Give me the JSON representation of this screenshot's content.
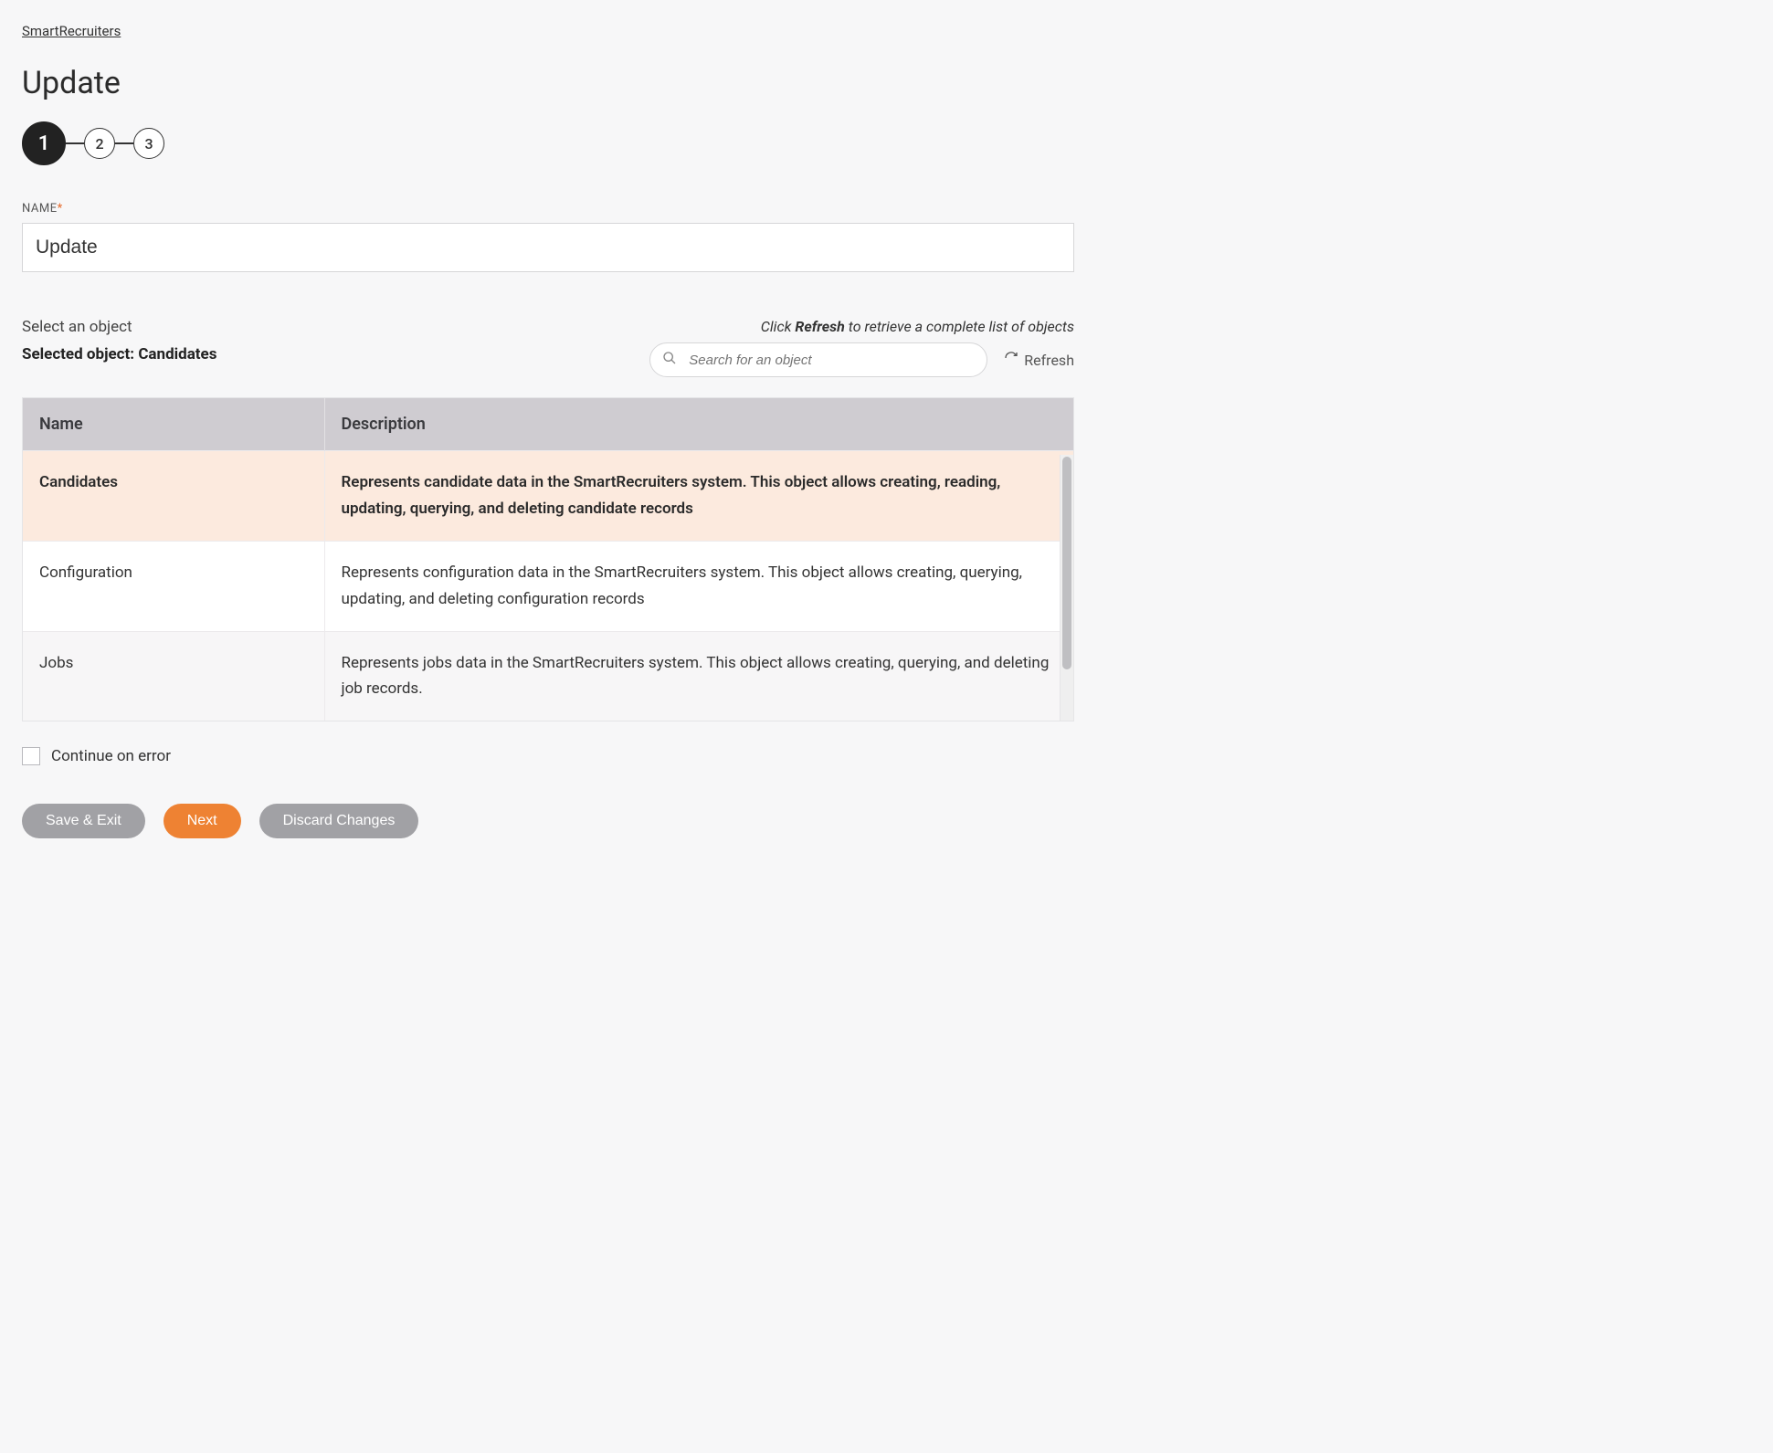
{
  "breadcrumb": "SmartRecruiters",
  "page_title": "Update",
  "stepper": {
    "steps": [
      "1",
      "2",
      "3"
    ],
    "active_index": 0
  },
  "name_field": {
    "label": "NAME",
    "required": "*",
    "value": "Update"
  },
  "object_section": {
    "select_label": "Select an object",
    "selected_prefix": "Selected object: ",
    "selected_name": "Candidates",
    "hint_prefix": "Click ",
    "hint_bold": "Refresh",
    "hint_suffix": " to retrieve a complete list of objects",
    "search_placeholder": "Search for an object",
    "refresh_label": "Refresh"
  },
  "table": {
    "headers": {
      "name": "Name",
      "description": "Description"
    },
    "rows": [
      {
        "name": "Candidates",
        "description": "Represents candidate data in the SmartRecruiters system. This object allows creating, reading, updating, querying, and deleting candidate records",
        "selected": true
      },
      {
        "name": "Configuration",
        "description": "Represents configuration data in the SmartRecruiters system. This object allows creating, querying, updating, and deleting configuration records",
        "selected": false
      },
      {
        "name": "Jobs",
        "description": "Represents jobs data in the SmartRecruiters system. This object allows creating, querying, and deleting job records.",
        "selected": false
      }
    ]
  },
  "continue_on_error_label": "Continue on error",
  "buttons": {
    "save_exit": "Save & Exit",
    "next": "Next",
    "discard": "Discard Changes"
  }
}
